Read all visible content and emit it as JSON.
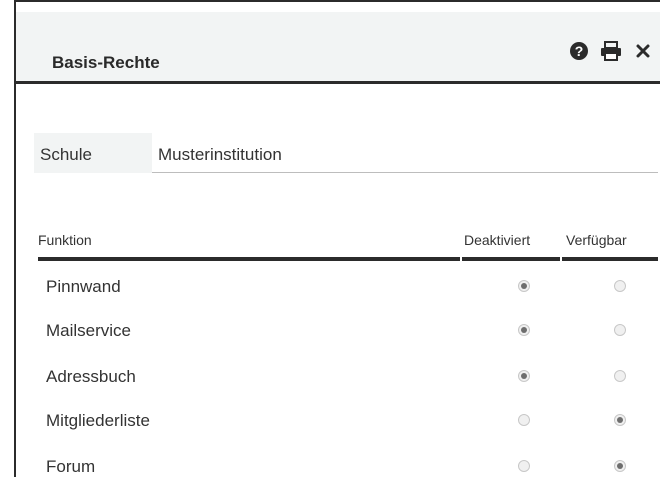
{
  "dialog": {
    "title": "Basis-Rechte",
    "icons": [
      "help-icon",
      "print-icon",
      "close-icon"
    ]
  },
  "school": {
    "label": "Schule",
    "value": "Musterinstitution"
  },
  "table": {
    "headers": {
      "function": "Funktion",
      "deactivated": "Deaktiviert",
      "available": "Verfügbar"
    },
    "rows": [
      {
        "label": "Pinnwand",
        "selected": "Deaktiviert"
      },
      {
        "label": "Mailservice",
        "selected": "Deaktiviert"
      },
      {
        "label": "Adressbuch",
        "selected": "Deaktiviert"
      },
      {
        "label": "Mitgliederliste",
        "selected": "Verfügbar"
      },
      {
        "label": "Forum",
        "selected": "Verfügbar"
      }
    ]
  }
}
